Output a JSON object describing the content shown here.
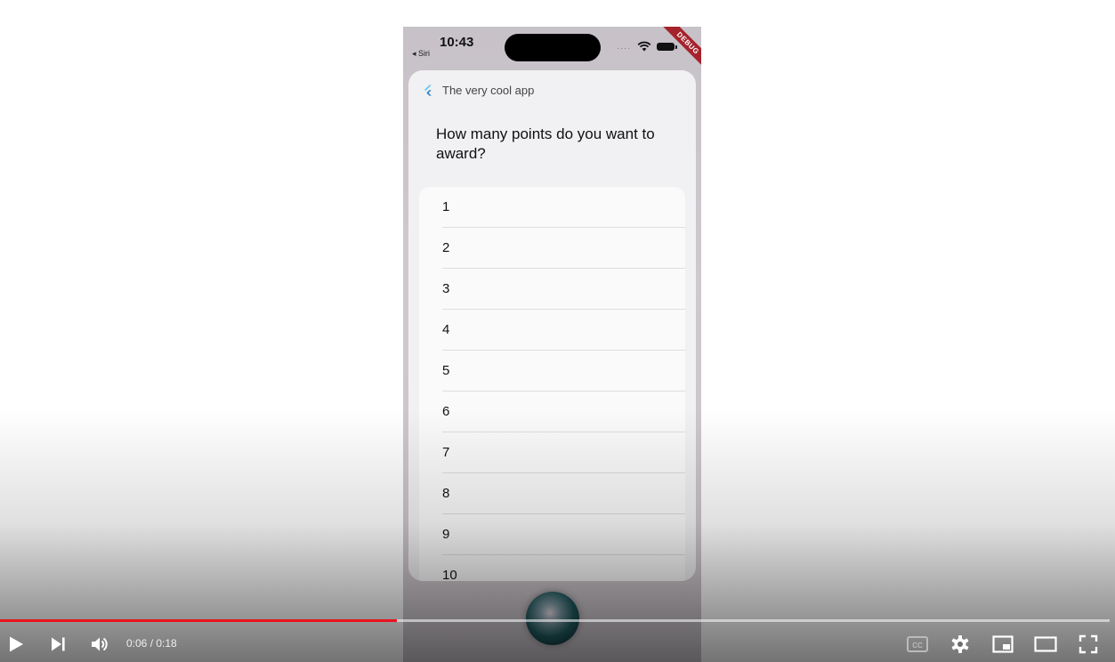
{
  "phone": {
    "status": {
      "time": "10:43",
      "back_label": "◂ Siri",
      "signal": "····",
      "debug_banner": "DEBUG"
    },
    "app_name": "The very cool app",
    "question": "How many points do you want to award?",
    "options": [
      "1",
      "2",
      "3",
      "4",
      "5",
      "6",
      "7",
      "8",
      "9",
      "10"
    ]
  },
  "player": {
    "time_display": "0:06 / 0:18",
    "progress": 0.358,
    "accent": "#e8131d",
    "icons": {
      "play": "play-icon",
      "next": "next-icon",
      "volume": "volume-icon",
      "captions": "captions-icon",
      "settings": "gear-icon",
      "miniplayer": "miniplayer-icon",
      "theater": "theater-icon",
      "fullscreen": "fullscreen-icon"
    }
  }
}
